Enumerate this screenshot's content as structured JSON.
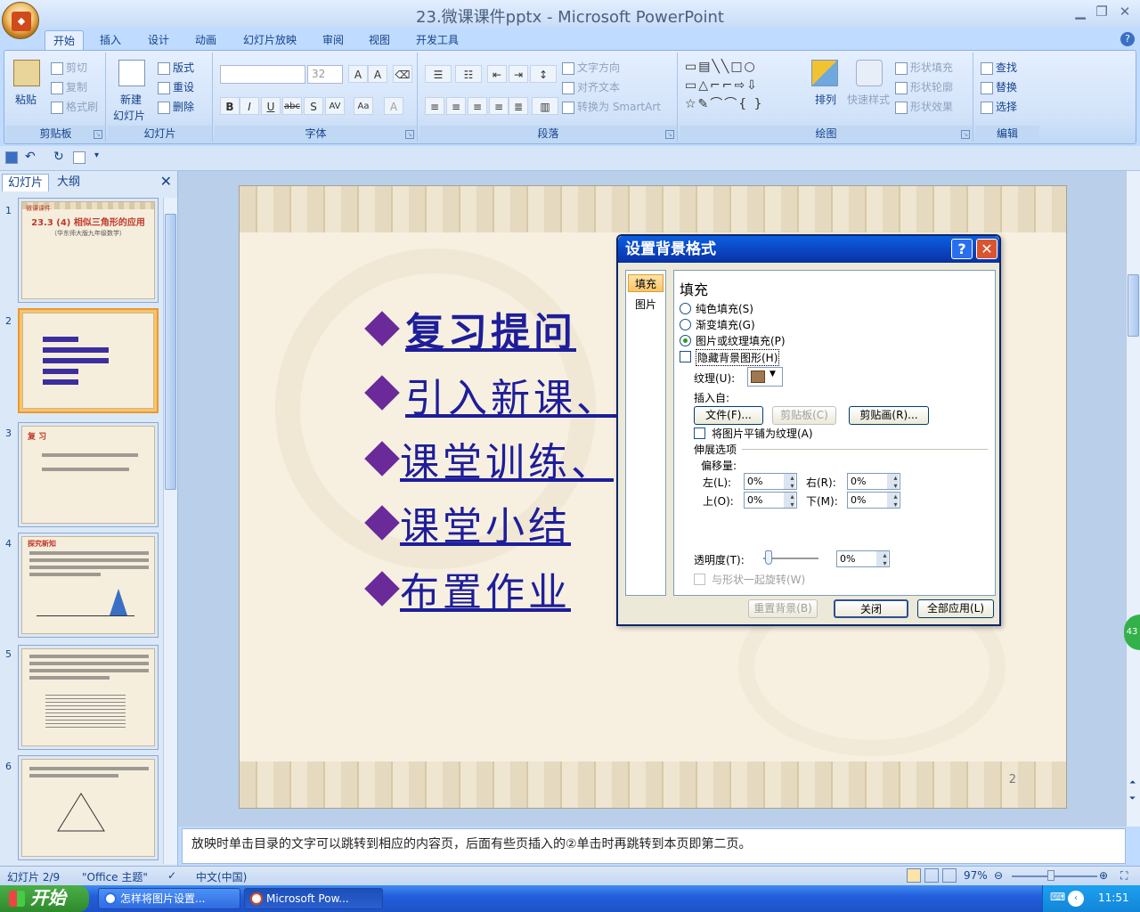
{
  "window": {
    "title": "23.微课课件pptx - Microsoft PowerPoint"
  },
  "tabs": [
    "开始",
    "插入",
    "设计",
    "动画",
    "幻灯片放映",
    "审阅",
    "视图",
    "开发工具"
  ],
  "ribbon": {
    "clipboard": {
      "label": "剪贴板",
      "paste": "粘贴",
      "cut": "剪切",
      "copy": "复制",
      "format_painter": "格式刷"
    },
    "slides": {
      "label": "幻灯片",
      "new_slide": "新建",
      "new_slide2": "幻灯片",
      "layout": "版式",
      "reset": "重设",
      "delete": "删除"
    },
    "font": {
      "label": "字体",
      "size": "32"
    },
    "paragraph": {
      "label": "段落",
      "text_direction": "文字方向",
      "align_text": "对齐文本",
      "smartart": "转换为 SmartArt"
    },
    "drawing": {
      "label": "绘图",
      "arrange": "排列",
      "quick_styles": "快速样式",
      "shape_fill": "形状填充",
      "shape_outline": "形状轮廓",
      "shape_effects": "形状效果"
    },
    "editing": {
      "label": "编辑",
      "find": "查找",
      "replace": "替换",
      "select": "选择"
    }
  },
  "left_pane": {
    "tab_slides": "幻灯片",
    "tab_outline": "大纲",
    "thumbnails": [
      {
        "num": "1",
        "title": "23.3 (4) 相似三角形的应用",
        "subtitle": "（华东师大版九年级数学）",
        "tag": "微课课件"
      },
      {
        "num": "2"
      },
      {
        "num": "3",
        "title": "复 习"
      },
      {
        "num": "4",
        "title": "探究新知"
      },
      {
        "num": "5"
      },
      {
        "num": "6"
      }
    ]
  },
  "slide": {
    "bullets": [
      "复习提问",
      "引入新课、",
      "课堂训练、",
      "课堂小结",
      "布置作业"
    ],
    "number": "2"
  },
  "dialog": {
    "title": "设置背景格式",
    "side": {
      "fill": "填充",
      "picture": "图片"
    },
    "heading": "填充",
    "radio_solid": "纯色填充(S)",
    "radio_gradient": "渐变填充(G)",
    "radio_picture": "图片或纹理填充(P)",
    "hide_bg": "隐藏背景图形(H)",
    "texture_label": "纹理(U):",
    "insert_from": "插入自:",
    "btn_file": "文件(F)...",
    "btn_clipboard": "剪贴板(C)",
    "btn_clipart": "剪贴画(R)...",
    "tile": "将图片平铺为纹理(A)",
    "stretch": "伸展选项",
    "offset": "偏移量:",
    "left": "左(L):",
    "right": "右(R):",
    "top": "上(O):",
    "bottom": "下(M):",
    "left_val": "0%",
    "right_val": "0%",
    "top_val": "0%",
    "bottom_val": "0%",
    "transparency": "透明度(T):",
    "transparency_val": "0%",
    "rotate_with_shape": "与形状一起旋转(W)",
    "btn_reset": "重置背景(B)",
    "btn_close": "关闭",
    "btn_apply_all": "全部应用(L)"
  },
  "notes": "放映时单击目录的文字可以跳转到相应的内容页，后面有些页插入的②单击时再跳转到本页即第二页。",
  "status": {
    "slide_info": "幻灯片 2/9",
    "theme": "\"Office 主题\"",
    "language": "中文(中国)",
    "zoom": "97%"
  },
  "taskbar": {
    "start": "开始",
    "task1": "怎样将图片设置...",
    "task2": "Microsoft Pow...",
    "time": "11:51"
  },
  "side_badge": "43"
}
